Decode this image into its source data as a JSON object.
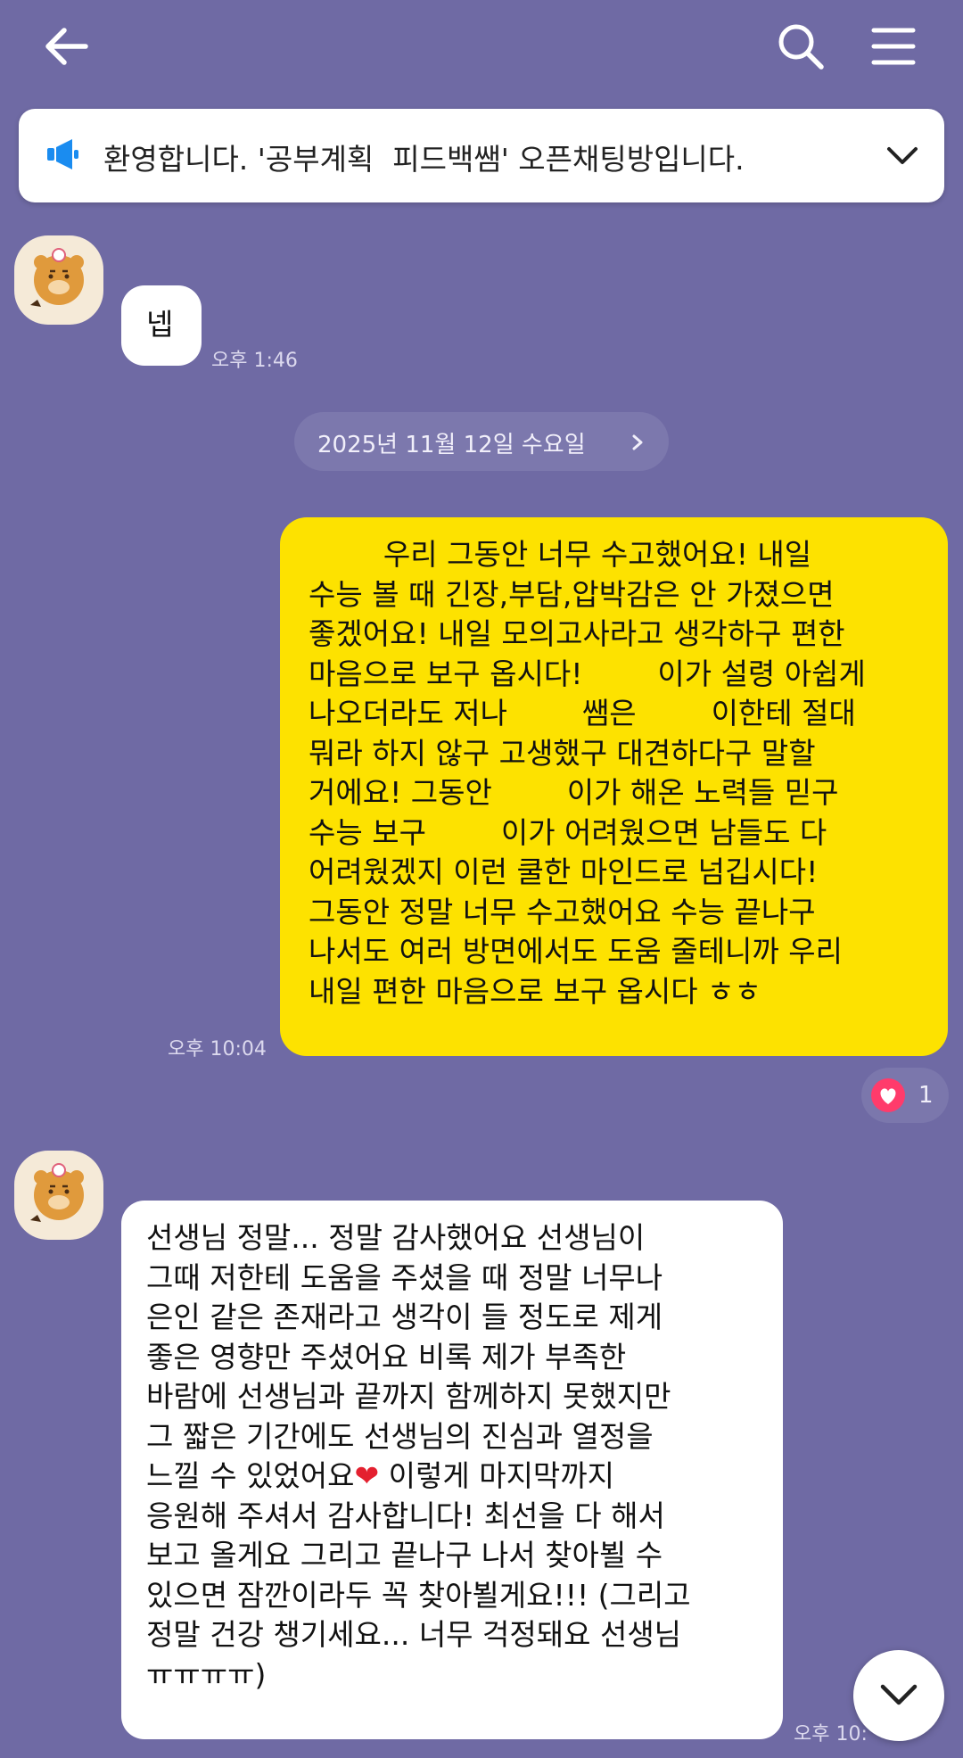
{
  "colors": {
    "background": "#6f6aa4",
    "my_bubble": "#fde200",
    "their_bubble": "#ffffff",
    "notice_icon": "#1a8cf0",
    "reaction_heart": "#ff3b6b"
  },
  "header": {
    "back_icon": "arrow-left",
    "search_icon": "search",
    "menu_icon": "hamburger"
  },
  "notice": {
    "icon": "megaphone",
    "text": "환영합니다. '공부계획  피드백쌤' 오픈채팅방입니다.",
    "expand_icon": "chevron-down"
  },
  "messages": {
    "m1": {
      "text": "넵",
      "time": "오후 1:46"
    },
    "date_divider": "2025년 11월 12일 수요일",
    "m2": {
      "text": "        우리 그동안 너무 수고했어요! 내일\n수능 볼 때 긴장,부담,압박감은 안 가졌으면\n좋겠어요! 내일 모의고사라고 생각하구 편한\n마음으로 보구 옵시다!        이가 설령 아쉽게\n나오더라도 저나        쌤은        이한테 절대\n뭐라 하지 않구 고생했구 대견하다구 말할\n거에요! 그동안        이가 해온 노력들 믿구\n수능 보구        이가 어려웠으면 남들도 다\n어려웠겠지 이런 쿨한 마인드로 넘깁시다!\n그동안 정말 너무 수고했어요 수능 끝나구\n나서도 여러 방면에서도 도움 줄테니까 우리\n내일 편한 마음으로 보구 옵시다 ㅎㅎ",
      "time": "오후 10:04",
      "reaction_count": "1"
    },
    "m3": {
      "text_before_heart": "선생님 정말... 정말 감사했어요 선생님이\n그때 저한테 도움을 주셨을 때 정말 너무나\n은인 같은 존재라고 생각이 들 정도로 제게\n좋은 영향만 주셨어요 비록 제가 부족한\n바람에 선생님과 끝까지 함께하지 못했지만\n그 짧은 기간에도 선생님의 진심과 열정을\n느낄 수 있었어요",
      "heart": "❤",
      "text_after_heart": " 이렇게 마지막까지\n응원해 주셔서 감사합니다! 최선을 다 해서\n보고 올게요 그리고 끝나구 나서 찾아뵐 수\n있으면 잠깐이라두 꼭 찾아뵐게요!!! (그리고\n정말 건강 챙기세요... 너무 걱정돼요 선생님\nㅠㅠㅠㅠ)",
      "time": "오후 10:"
    }
  },
  "scroll_down_icon": "chevron-down"
}
